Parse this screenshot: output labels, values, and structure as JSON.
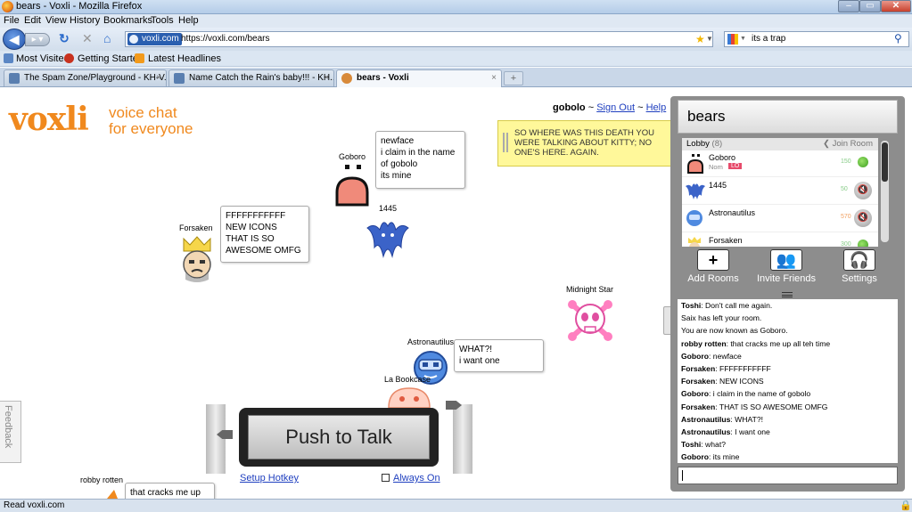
{
  "window": {
    "title": "bears - Voxli - Mozilla Firefox"
  },
  "menu": [
    "File",
    "Edit",
    "View",
    "History",
    "Bookmarks",
    "Tools",
    "Help"
  ],
  "nav": {
    "site": "voxli.com",
    "url": "https://voxli.com/bears",
    "search": "its a trap"
  },
  "bookmarks": [
    "Most Visited",
    "Getting Started",
    "Latest Headlines"
  ],
  "tabs": [
    {
      "label": "The Spam Zone/Playground - KH-V...",
      "active": false
    },
    {
      "label": "Name Catch the Rain's baby!!! - KH...",
      "active": false
    },
    {
      "label": "bears - Voxli",
      "active": true
    }
  ],
  "logo": {
    "brand": "voxli",
    "tag1": "voice chat",
    "tag2": "for everyone"
  },
  "account": {
    "user": "gobolo",
    "sep": "~",
    "signout": "Sign Out",
    "help": "Help"
  },
  "shout": "SO WHERE WAS THIS DEATH YOU WERE TALKING ABOUT KITTY; NO ONE'S HERE. AGAIN.",
  "stage": {
    "goboro": {
      "name": "Goboro",
      "lines": [
        "newface",
        "i claim in the name",
        "of gobolo",
        "its mine"
      ]
    },
    "u1445": {
      "name": "1445"
    },
    "forsaken": {
      "name": "Forsaken",
      "lines": [
        "FFFFFFFFFFF",
        "NEW ICONS",
        "THAT IS SO",
        "AWESOME OMFG"
      ]
    },
    "midnight": {
      "name": "Midnight Star"
    },
    "astro": {
      "name": "Astronautilus",
      "lines": [
        "WHAT?!",
        "i want one"
      ]
    },
    "labook": {
      "name": "La Bookcase"
    },
    "robby": {
      "name": "robby rotten",
      "lines": [
        "that cracks me up"
      ]
    }
  },
  "ptt": {
    "label": "Push to Talk",
    "setup": "Setup Hotkey",
    "always": "Always On"
  },
  "feedback": "Feedback",
  "room": {
    "title": "bears",
    "lobby": "Lobby",
    "count": "(8)",
    "join": "Join Room",
    "users": [
      {
        "name": "Goboro",
        "sub": "Nom",
        "badge": "LO",
        "num": "150"
      },
      {
        "name": "1445",
        "num": "50"
      },
      {
        "name": "Astronautilus",
        "num": "570"
      },
      {
        "name": "Forsaken",
        "num": "300"
      }
    ],
    "actions": [
      "Add Rooms",
      "Invite Friends",
      "Settings"
    ]
  },
  "chat": [
    {
      "who": "Toshi",
      "text": ": Don't call me again."
    },
    {
      "who": "",
      "text": "Saix has left your room."
    },
    {
      "who": "",
      "text": "You are now known as Goboro."
    },
    {
      "who": "robby rotten",
      "text": ": that cracks me up all teh time"
    },
    {
      "who": "Goboro",
      "text": ": newface"
    },
    {
      "who": "Forsaken",
      "text": ": FFFFFFFFFFF"
    },
    {
      "who": "Forsaken",
      "text": ": NEW ICONS"
    },
    {
      "who": "Goboro",
      "text": ": i claim in the name of gobolo"
    },
    {
      "who": "Forsaken",
      "text": ": THAT IS SO AWESOME OMFG"
    },
    {
      "who": "Astronautilus",
      "text": ": WHAT?!"
    },
    {
      "who": "Astronautilus",
      "text": ": I want one"
    },
    {
      "who": "Toshi",
      "text": ": what?"
    },
    {
      "who": "Goboro",
      "text": ": its mine"
    }
  ],
  "status": "Read voxli.com"
}
